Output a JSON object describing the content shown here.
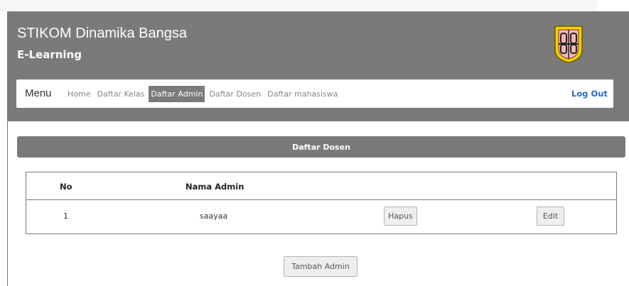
{
  "header": {
    "title": "STIKOM Dinamika Bangsa",
    "subtitle": "E-Learning",
    "logo_icon": "university-shield-logo"
  },
  "navbar": {
    "brand": "Menu",
    "links": [
      "Home",
      "Daftar Kelas",
      "Daftar Admin",
      "Daftar Dosen",
      "Daftar mahasiswa"
    ],
    "active_link": "Daftar Admin",
    "logout": "Log Out"
  },
  "panel": {
    "title": "Daftar Dosen"
  },
  "table": {
    "columns": [
      "No",
      "Nama Admin"
    ],
    "rows": [
      {
        "no": "1",
        "nama": "saayaa",
        "delete_label": "Hapus",
        "edit_label": "Edit"
      }
    ]
  },
  "actions": {
    "add_label": "Tambah Admin"
  },
  "colors": {
    "header_bg": "#7a7a7a",
    "link_blue": "#2a6ad1",
    "button_bg": "#eeeeee"
  }
}
